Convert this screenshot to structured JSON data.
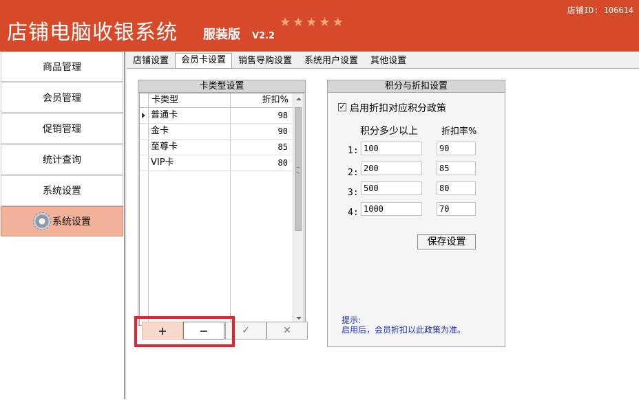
{
  "header": {
    "title": "店铺电脑收银系统",
    "edition": "服装版",
    "version": "V2.2",
    "store_id": "店铺ID: 106614",
    "rating_stars": 5
  },
  "sidebar": {
    "items": [
      {
        "label": "商品管理"
      },
      {
        "label": "会员管理"
      },
      {
        "label": "促销管理"
      },
      {
        "label": "统计查询"
      },
      {
        "label": "系统设置"
      },
      {
        "label": "系统设置",
        "active": true,
        "icon": "gear-icon"
      }
    ]
  },
  "tabs": [
    {
      "label": "店铺设置"
    },
    {
      "label": "会员卡设置",
      "active": true
    },
    {
      "label": "销售导购设置"
    },
    {
      "label": "系统用户设置"
    },
    {
      "label": "其他设置"
    }
  ],
  "card_types": {
    "title": "卡类型设置",
    "columns": [
      "卡类型",
      "折扣%"
    ],
    "rows": [
      {
        "name": "普通卡",
        "discount": "98"
      },
      {
        "name": "金卡",
        "discount": "90"
      },
      {
        "name": "至尊卡",
        "discount": "85"
      },
      {
        "name": "VIP卡",
        "discount": "80"
      }
    ],
    "buttons": {
      "add": "+",
      "remove": "−",
      "confirm": "✓",
      "cancel": "✕"
    }
  },
  "points": {
    "title": "积分与折扣设置",
    "checkbox_label": "启用折扣对应积分政策",
    "checkbox_checked": true,
    "col_points": "积分多少以上",
    "col_rate": "折扣率%",
    "rows": [
      {
        "idx": "1:",
        "points": "100",
        "rate": "90"
      },
      {
        "idx": "2:",
        "points": "200",
        "rate": "85"
      },
      {
        "idx": "3:",
        "points": "500",
        "rate": "80"
      },
      {
        "idx": "4:",
        "points": "1000",
        "rate": "70"
      }
    ],
    "save_button": "保存设置",
    "hint_title": "提示:",
    "hint_text": "启用后，会员折扣以此政策为准。"
  },
  "colors": {
    "header_bg": "#d64a2a",
    "sidebar_active": "#f2b199",
    "highlight": "#ee2030",
    "hint_text": "#1a2fc0"
  }
}
